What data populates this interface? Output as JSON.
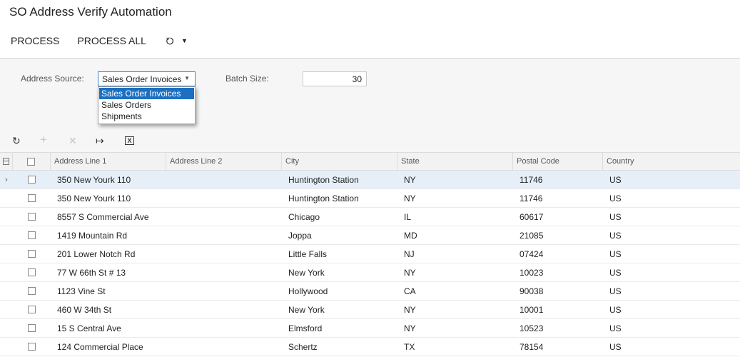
{
  "page": {
    "title": "SO Address Verify Automation"
  },
  "toolbar": {
    "process_label": "PROCESS",
    "process_all_label": "PROCESS ALL",
    "undo_icon": "undo-icon",
    "caret_icon": "caret-down-icon"
  },
  "filters": {
    "address_source_label": "Address Source:",
    "address_source_value": "Sales Order Invoices",
    "address_source_options": [
      "Sales Order Invoices",
      "Sales Orders",
      "Shipments"
    ],
    "batch_size_label": "Batch Size:",
    "batch_size_value": "30"
  },
  "grid": {
    "columns": [
      "Address Line 1",
      "Address Line 2",
      "City",
      "State",
      "Postal Code",
      "Country"
    ],
    "rows": [
      {
        "addr1": "350 New Yourk 110",
        "addr2": "",
        "city": "Huntington Station",
        "state": "NY",
        "zip": "11746",
        "country": "US"
      },
      {
        "addr1": "350 New Yourk 110",
        "addr2": "",
        "city": "Huntington Station",
        "state": "NY",
        "zip": "11746",
        "country": "US"
      },
      {
        "addr1": "8557 S Commercial Ave",
        "addr2": "",
        "city": "Chicago",
        "state": "IL",
        "zip": "60617",
        "country": "US"
      },
      {
        "addr1": "1419 Mountain Rd",
        "addr2": "",
        "city": "Joppa",
        "state": "MD",
        "zip": "21085",
        "country": "US"
      },
      {
        "addr1": "201 Lower Notch Rd",
        "addr2": "",
        "city": "Little Falls",
        "state": "NJ",
        "zip": "07424",
        "country": "US"
      },
      {
        "addr1": "77 W 66th St # 13",
        "addr2": "",
        "city": "New York",
        "state": "NY",
        "zip": "10023",
        "country": "US"
      },
      {
        "addr1": "1123 Vine St",
        "addr2": "",
        "city": "Hollywood",
        "state": "CA",
        "zip": "90038",
        "country": "US"
      },
      {
        "addr1": "460 W 34th St",
        "addr2": "",
        "city": "New York",
        "state": "NY",
        "zip": "10001",
        "country": "US"
      },
      {
        "addr1": "15 S Central Ave",
        "addr2": "",
        "city": "Elmsford",
        "state": "NY",
        "zip": "10523",
        "country": "US"
      },
      {
        "addr1": "124 Commercial Place",
        "addr2": "",
        "city": "Schertz",
        "state": "TX",
        "zip": "78154",
        "country": "US"
      }
    ]
  },
  "colors": {
    "accent": "#1d6fc1",
    "active_row": "#e6eff8",
    "panel_bg": "#f6f6f6"
  }
}
